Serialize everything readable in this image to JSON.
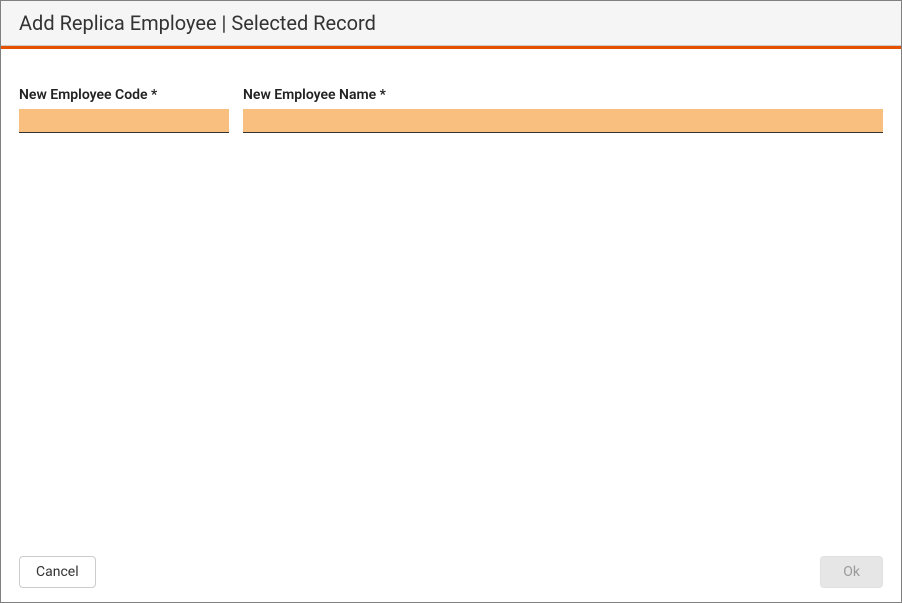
{
  "header": {
    "title": "Add Replica Employee | Selected Record"
  },
  "form": {
    "employee_code": {
      "label": "New Employee Code *",
      "value": ""
    },
    "employee_name": {
      "label": "New Employee Name *",
      "value": ""
    }
  },
  "footer": {
    "cancel_label": "Cancel",
    "ok_label": "Ok"
  },
  "colors": {
    "accent": "#e65100",
    "input_highlight": "#f8bf7e"
  }
}
